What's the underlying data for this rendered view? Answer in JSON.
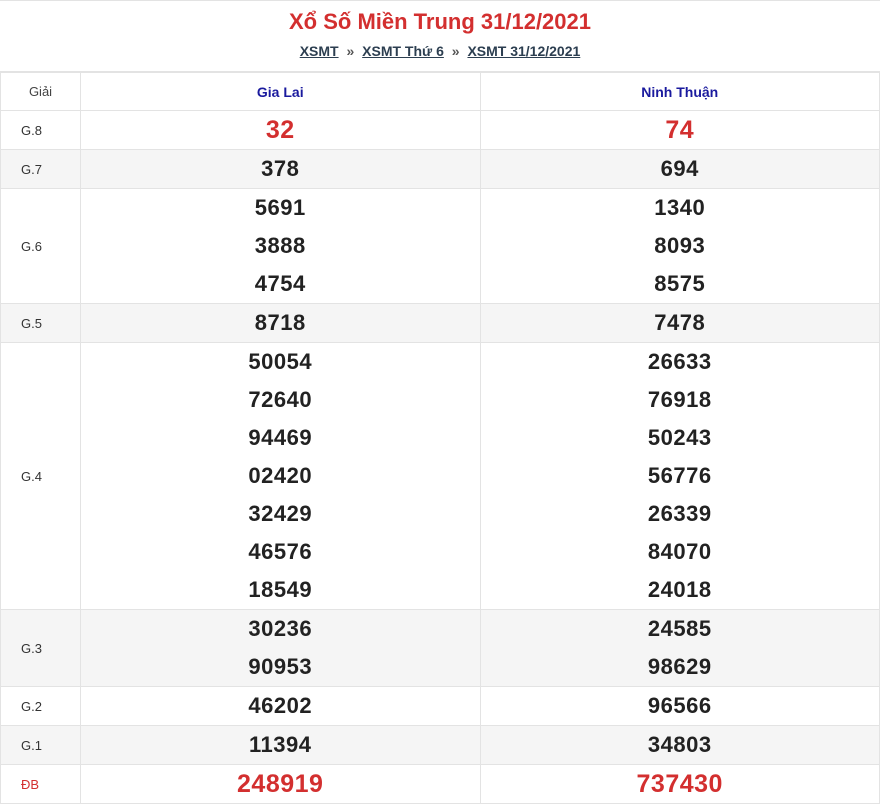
{
  "header": {
    "title": "Xổ Số Miền Trung 31/12/2021",
    "breadcrumb": [
      "XSMT",
      "XSMT Thứ 6",
      "XSMT 31/12/2021"
    ],
    "separator": "»"
  },
  "table": {
    "prize_header": "Giải",
    "provinces": [
      "Gia Lai",
      "Ninh Thuận"
    ],
    "rows": [
      {
        "label": "G.8",
        "left": [
          "32"
        ],
        "right": [
          "74"
        ]
      },
      {
        "label": "G.7",
        "left": [
          "378"
        ],
        "right": [
          "694"
        ]
      },
      {
        "label": "G.6",
        "left": [
          "5691",
          "3888",
          "4754"
        ],
        "right": [
          "1340",
          "8093",
          "8575"
        ]
      },
      {
        "label": "G.5",
        "left": [
          "8718"
        ],
        "right": [
          "7478"
        ]
      },
      {
        "label": "G.4",
        "left": [
          "50054",
          "72640",
          "94469",
          "02420",
          "32429",
          "46576",
          "18549"
        ],
        "right": [
          "26633",
          "76918",
          "50243",
          "56776",
          "26339",
          "84070",
          "24018"
        ]
      },
      {
        "label": "G.3",
        "left": [
          "30236",
          "90953"
        ],
        "right": [
          "24585",
          "98629"
        ]
      },
      {
        "label": "G.2",
        "left": [
          "46202"
        ],
        "right": [
          "96566"
        ]
      },
      {
        "label": "G.1",
        "left": [
          "11394"
        ],
        "right": [
          "34803"
        ]
      },
      {
        "label": "ĐB",
        "left": [
          "248919"
        ],
        "right": [
          "737430"
        ]
      }
    ]
  },
  "colors": {
    "accent_red": "#d32f2f",
    "province_blue": "#1a1a9e",
    "alt_row": "#f5f5f5"
  }
}
